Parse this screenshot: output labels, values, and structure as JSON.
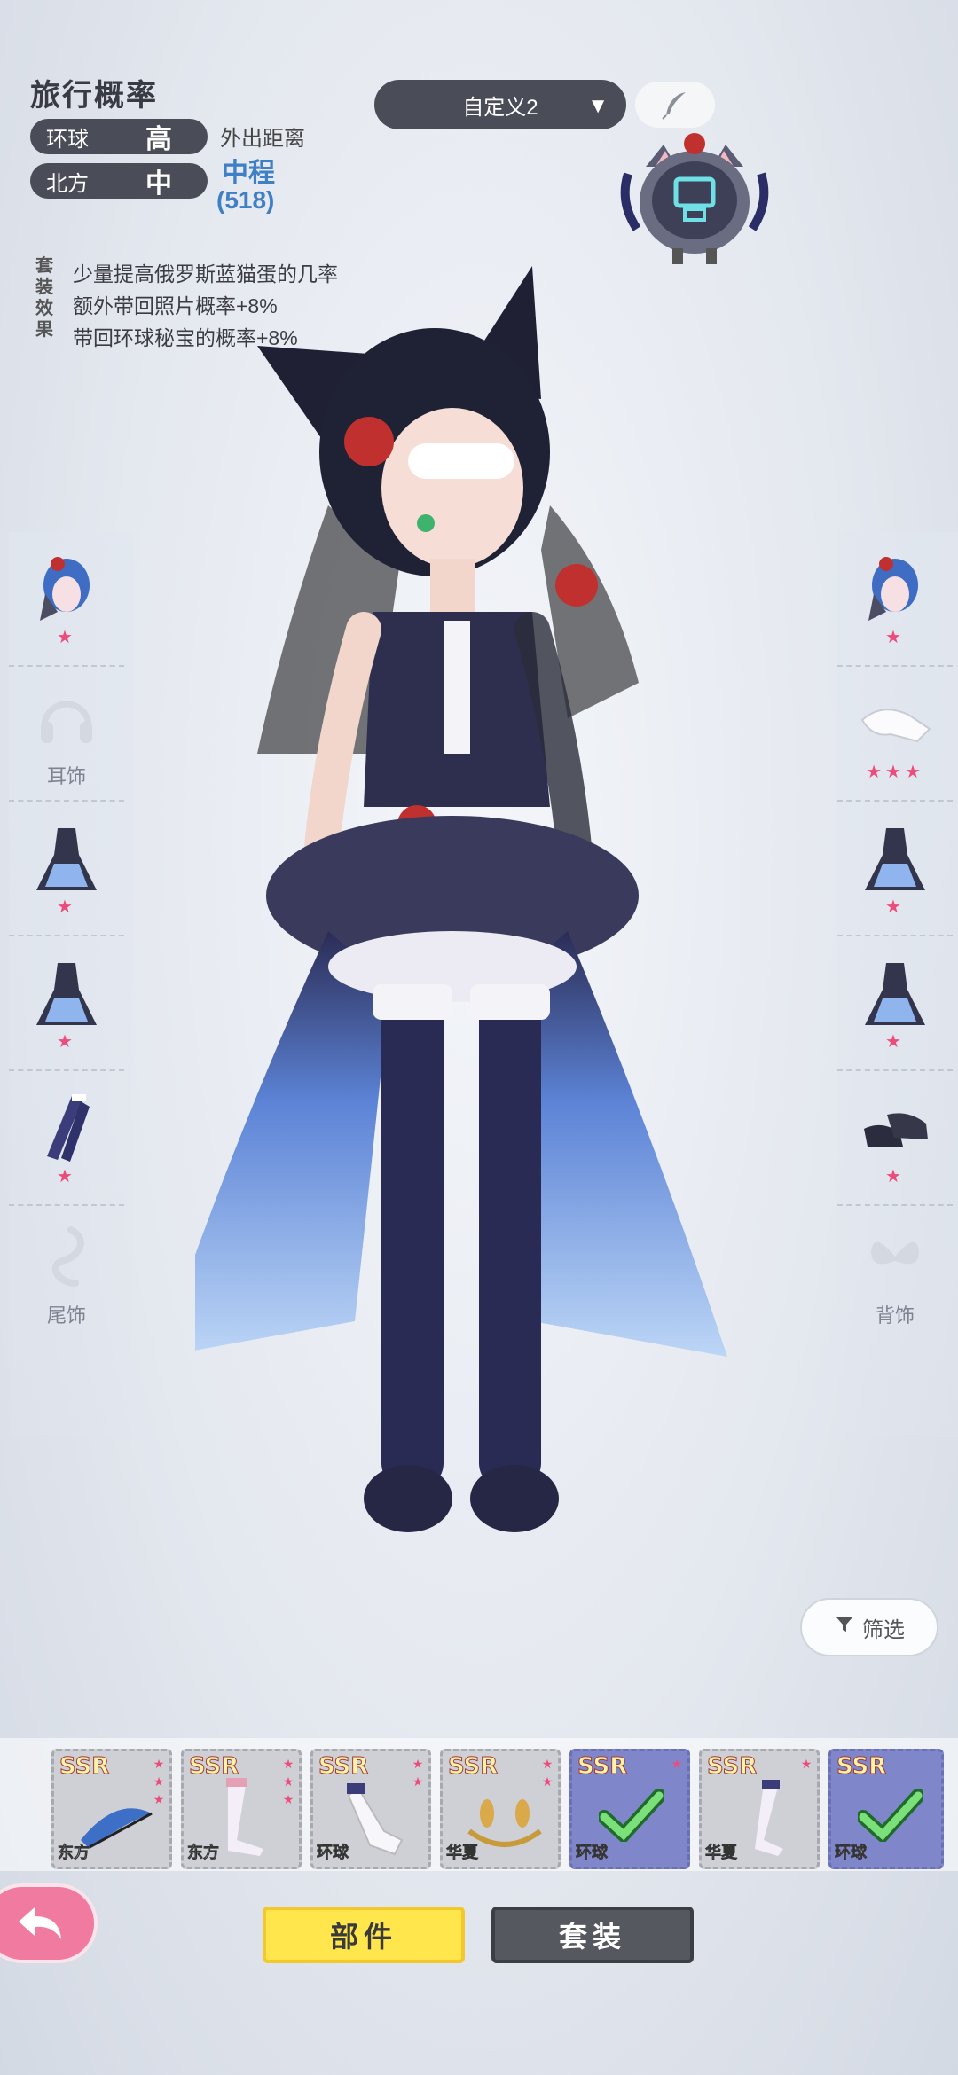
{
  "header": {
    "title": "旅行概率",
    "rows": [
      {
        "key": "环球",
        "value": "高"
      },
      {
        "key": "北方",
        "value": "中"
      }
    ],
    "distance_label": "外出距离",
    "distance_value": "中程",
    "distance_number": "(518)"
  },
  "set_effect": {
    "tag": "套装效果",
    "lines": [
      "少量提高俄罗斯蓝猫蛋的几率",
      "额外带回照片概率+8%",
      "带回环球秘宝的概率+8%"
    ]
  },
  "preset": {
    "selected": "自定义2",
    "arrow": "▼",
    "edit_icon": "feather-icon"
  },
  "left_slots": [
    {
      "label": "",
      "stars": "★",
      "icon": "hair-icon"
    },
    {
      "label": "耳饰",
      "stars": "",
      "icon": "headphones-icon"
    },
    {
      "label": "",
      "stars": "★",
      "icon": "dress-icon"
    },
    {
      "label": "",
      "stars": "★",
      "icon": "dress-icon"
    },
    {
      "label": "",
      "stars": "★",
      "icon": "stockings-icon"
    },
    {
      "label": "尾饰",
      "stars": "",
      "icon": "tail-icon"
    }
  ],
  "right_slots": [
    {
      "label": "",
      "stars": "★",
      "icon": "hair-icon"
    },
    {
      "label": "",
      "stars": "★★★",
      "icon": "gloves-icon"
    },
    {
      "label": "",
      "stars": "★",
      "icon": "dress-icon"
    },
    {
      "label": "",
      "stars": "★",
      "icon": "dress-icon"
    },
    {
      "label": "",
      "stars": "★",
      "icon": "shoes-icon"
    },
    {
      "label": "背饰",
      "stars": "",
      "icon": "wings-icon"
    }
  ],
  "filter_label": "筛选",
  "items": [
    {
      "rarity": "SSR",
      "region": "东方",
      "selected": false,
      "icon": "feather-hairpin-icon"
    },
    {
      "rarity": "SSR",
      "region": "东方",
      "selected": false,
      "icon": "stockings-icon"
    },
    {
      "rarity": "SSR",
      "region": "环球",
      "selected": false,
      "icon": "sock-icon"
    },
    {
      "rarity": "SSR",
      "region": "华夏",
      "selected": false,
      "icon": "laurel-icon"
    },
    {
      "rarity": "SSR",
      "region": "环球",
      "selected": true,
      "icon": "check-icon"
    },
    {
      "rarity": "SSR",
      "region": "华夏",
      "selected": false,
      "icon": "stockings-icon"
    },
    {
      "rarity": "SSR",
      "region": "环球",
      "selected": true,
      "icon": "check-icon"
    }
  ],
  "tabs": {
    "parts": "部件",
    "sets": "套装"
  },
  "colors": {
    "accent_blue": "#3f7fc6",
    "star_pink": "#ec4c7a",
    "tab_yellow": "#ffe64d",
    "panel_dark": "#4a4d57"
  }
}
